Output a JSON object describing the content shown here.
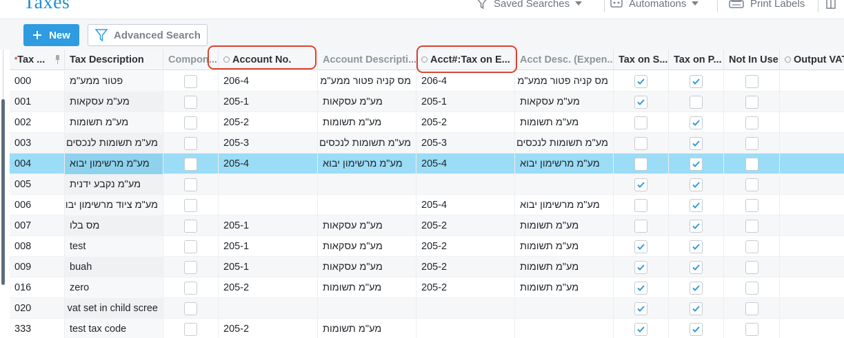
{
  "page": {
    "title": "Taxes"
  },
  "topbar": {
    "saved_searches": "Saved Searches",
    "automations": "Automations",
    "print_labels": "Print Labels"
  },
  "toolbar": {
    "new_label": "New",
    "advanced_search_label": "Advanced Search"
  },
  "columns": [
    {
      "key": "tax_id",
      "label": "Tax ...",
      "required": true
    },
    {
      "key": "description",
      "label": "Tax Description"
    },
    {
      "key": "component",
      "label": "Compon..."
    },
    {
      "key": "account_no",
      "label": "Account No."
    },
    {
      "key": "account_desc",
      "label": "Account Descripti..."
    },
    {
      "key": "acct_tax_expense",
      "label": "Acct#:Tax on E..."
    },
    {
      "key": "acct_desc_expense",
      "label": "Acct Desc. (Expen..."
    },
    {
      "key": "tax_on_s",
      "label": "Tax on S..."
    },
    {
      "key": "tax_on_p",
      "label": "Tax on P..."
    },
    {
      "key": "not_in_use",
      "label": "Not In Use"
    },
    {
      "key": "output_vat",
      "label": "Output VAT"
    }
  ],
  "highlighted_columns": [
    "Account No.",
    "Acct#:Tax on E..."
  ],
  "rows": [
    {
      "tax_id": "000",
      "description": "פטור ממע\"מ",
      "component": false,
      "account_no": "206-4",
      "account_desc": "מס קניה פטור ממע\"מ",
      "acct_tax_expense": "206-4",
      "acct_desc_expense": "מס קניה פטור ממע\"מ",
      "tax_on_s": true,
      "tax_on_p": true,
      "not_in_use": false
    },
    {
      "tax_id": "001",
      "description": "מע\"מ עסקאות",
      "component": false,
      "account_no": "205-1",
      "account_desc": "מע\"מ עסקאות",
      "acct_tax_expense": "205-1",
      "acct_desc_expense": "מע\"מ עסקאות",
      "tax_on_s": true,
      "tax_on_p": false,
      "not_in_use": false
    },
    {
      "tax_id": "002",
      "description": "מע\"מ תשומות",
      "component": false,
      "account_no": "205-2",
      "account_desc": "מע\"מ תשומות",
      "acct_tax_expense": "205-2",
      "acct_desc_expense": "מע\"מ תשומות",
      "tax_on_s": false,
      "tax_on_p": true,
      "not_in_use": false
    },
    {
      "tax_id": "003",
      "description": "מע\"מ תשומות לנכסים",
      "component": false,
      "account_no": "205-3",
      "account_desc": "מע\"מ תשומות לנכסים",
      "acct_tax_expense": "205-3",
      "acct_desc_expense": "מע\"מ תשומות לנכסים",
      "tax_on_s": false,
      "tax_on_p": true,
      "not_in_use": false
    },
    {
      "tax_id": "004",
      "description": "מע\"מ מרשימון יבוא",
      "component": false,
      "account_no": "205-4",
      "account_desc": "מע\"מ מרשימון יבוא",
      "acct_tax_expense": "205-4",
      "acct_desc_expense": "מע\"מ מרשימון יבוא",
      "tax_on_s": false,
      "tax_on_p": true,
      "not_in_use": false,
      "selected": true
    },
    {
      "tax_id": "005",
      "description": "מע\"מ נקבע ידנית",
      "component": false,
      "account_no": "",
      "account_desc": "",
      "acct_tax_expense": "",
      "acct_desc_expense": "",
      "tax_on_s": true,
      "tax_on_p": true,
      "not_in_use": false
    },
    {
      "tax_id": "006",
      "description": "מע\"מ ציוד מרשימון יבוא",
      "component": false,
      "account_no": "",
      "account_desc": "",
      "acct_tax_expense": "205-4",
      "acct_desc_expense": "מע\"מ מרשימון יבוא",
      "tax_on_s": false,
      "tax_on_p": true,
      "not_in_use": false
    },
    {
      "tax_id": "007",
      "description": "מס בלו",
      "component": false,
      "account_no": "205-1",
      "account_desc": "מע\"מ עסקאות",
      "acct_tax_expense": "205-2",
      "acct_desc_expense": "מע\"מ תשומות",
      "tax_on_s": false,
      "tax_on_p": true,
      "not_in_use": false
    },
    {
      "tax_id": "008",
      "description": "test",
      "component": false,
      "account_no": "205-1",
      "account_desc": "מע\"מ עסקאות",
      "acct_tax_expense": "205-2",
      "acct_desc_expense": "מע\"מ תשומות",
      "tax_on_s": true,
      "tax_on_p": true,
      "not_in_use": false
    },
    {
      "tax_id": "009",
      "description": "buah",
      "component": false,
      "account_no": "205-1",
      "account_desc": "מע\"מ עסקאות",
      "acct_tax_expense": "205-2",
      "acct_desc_expense": "מע\"מ תשומות",
      "tax_on_s": true,
      "tax_on_p": true,
      "not_in_use": false
    },
    {
      "tax_id": "016",
      "description": "zero",
      "component": false,
      "account_no": "205-2",
      "account_desc": "מע\"מ תשומות",
      "acct_tax_expense": "205-2",
      "acct_desc_expense": "מע\"מ תשומות",
      "tax_on_s": true,
      "tax_on_p": true,
      "not_in_use": false
    },
    {
      "tax_id": "020",
      "description": "vat set in child scree",
      "component": false,
      "account_no": "",
      "account_desc": "",
      "acct_tax_expense": "",
      "acct_desc_expense": "",
      "tax_on_s": true,
      "tax_on_p": true,
      "not_in_use": false
    },
    {
      "tax_id": "333",
      "description": "test tax code",
      "component": false,
      "account_no": "205-2",
      "account_desc": "מע\"מ תשומות",
      "acct_tax_expense": "",
      "acct_desc_expense": "",
      "tax_on_s": true,
      "tax_on_p": true,
      "not_in_use": false
    }
  ]
}
